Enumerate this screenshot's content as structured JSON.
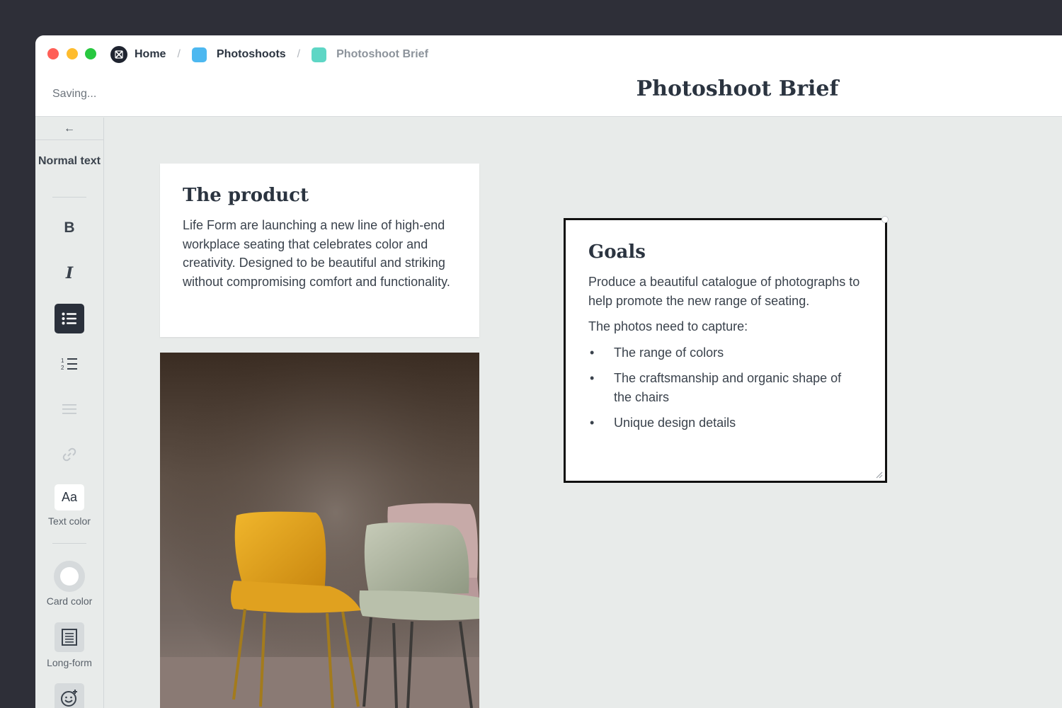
{
  "breadcrumb": {
    "home": "Home",
    "parent": "Photoshoots",
    "current": "Photoshoot Brief",
    "separator": "/"
  },
  "status": "Saving...",
  "document_title": "Photoshoot Brief",
  "toolbar": {
    "back": "←",
    "text_style": "Normal text",
    "bold": "B",
    "italic": "I",
    "text_color_glyph": "Aa",
    "text_color_label": "Text color",
    "card_color_label": "Card color",
    "long_form_label": "Long-form"
  },
  "cards": {
    "product": {
      "title": "The product",
      "body": "Life Form are launching a new line of high-end workplace seating that celebrates color and creativity. Designed to be beautiful and striking without compromising comfort and functionality."
    },
    "goals": {
      "title": "Goals",
      "intro": "Produce a beautiful catalogue of photographs to help promote the new range of seating.",
      "lead": "The photos need to capture:",
      "items": [
        "The range of colors",
        "The craftsmanship and organic shape of the chairs",
        "Unique design details"
      ]
    }
  },
  "colors": {
    "frame_bg": "#2e2f38",
    "canvas_bg": "#e8ebea",
    "active_tool": "#2a303b",
    "parent_icon": "#4db8f0",
    "current_icon": "#5ed6c5",
    "chair_yellow": "#e3a72a",
    "chair_sage": "#a9b29b",
    "chair_pink": "#c7aaa8"
  },
  "icons": {
    "home": "milanote-logo-icon",
    "bulleted_list": "bulleted-list-icon",
    "numbered_list": "numbered-list-icon",
    "align": "align-icon",
    "link": "link-icon",
    "long_form": "document-icon",
    "emoji": "add-emoji-icon"
  }
}
